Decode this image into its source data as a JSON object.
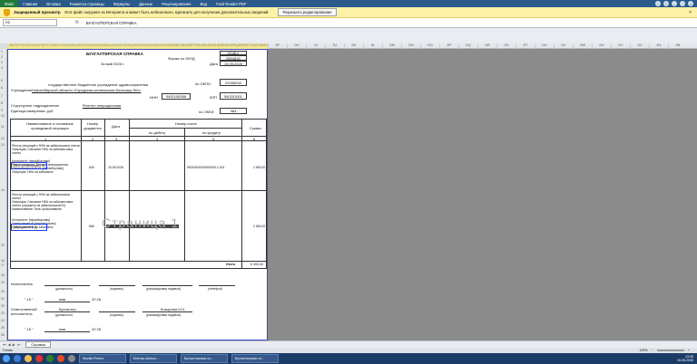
{
  "ribbon": {
    "file_tab": "Файл",
    "tabs": [
      "Главная",
      "Вставка",
      "Разметка страницы",
      "Формулы",
      "Данные",
      "Рецензирование",
      "Вид",
      "Foxit Reader PDF"
    ]
  },
  "protected_view": {
    "title": "Защищенный просмотр",
    "message": "Этот файл загружен из Интернета и может быть небезопасен. Щелкните для получения дополнительных сведений.",
    "enable_button": "Разрешить редактирование"
  },
  "formula_bar": {
    "cell": "A1",
    "fx": "fx",
    "value": "БУХГАЛТЕРСКАЯ СПРАВКА"
  },
  "column_headers": [
    "DF",
    "DH",
    "DI",
    "DJ",
    "DK",
    "DL",
    "DM",
    "DN",
    "DO",
    "DP",
    "DQ",
    "DR",
    "DS",
    "DT",
    "DU",
    "DV",
    "DW",
    "DX",
    "DY",
    "DZ",
    "EA",
    "EB"
  ],
  "row_numbers": [
    "1",
    "2",
    "3",
    "4",
    "5",
    "6",
    "7",
    "8",
    "9",
    "10",
    "11",
    "12",
    "13",
    "14",
    "15",
    "16",
    "17",
    "18",
    "19",
    "20",
    "21",
    "22",
    "23",
    "24",
    "25",
    "26"
  ],
  "document": {
    "title": "БУХГАЛТЕРСКАЯ СПРАВКА",
    "kody": "КОДЫ",
    "okud_label": "Форма по ОКУД",
    "okud": "0504833",
    "date_line": "За май 2026 г.",
    "date_label": "Дата",
    "date": "15.05.2026",
    "org1": "государственное бюджетное учреждение здравоохранения",
    "org2": "Новосибирской области «Городская клиническая больница №1»",
    "org_label": "Учреждение",
    "okpo_label": "по ОКПО",
    "okpo": "01936534",
    "inn_label": "ИНН",
    "inn": "5402108356",
    "kpp_label": "КПП",
    "kpp": "540201001",
    "dept_label": "Структурное подразделение",
    "dept": "Рентген операционная",
    "unit_label": "Единица измерения: руб.",
    "okei_label": "по ОКЕИ",
    "okei": "383",
    "col_name": "Наименование и основание проводимой операции",
    "col_num": "Номер документа",
    "col_date": "Дата",
    "col_acc": "Номер счета",
    "col_debit": "по дебету",
    "col_credit": "по кредиту",
    "col_sum": "Сумма",
    "idx": [
      "1",
      "2",
      "3",
      "4",
      "5",
      "6"
    ],
    "row1_text": [
      "Реестр операций с НФА на забалансовых счетах",
      "Операция: Списание НФА на забалансовых",
      "счетах",
      "",
      "Контрагент: [неразборчиво]",
      "Место хранения: Рентген операционная,",
      "Ответственный МОЛ: [неразборчиво]",
      "Операция: НФА на забалансе"
    ],
    "row1_tag": "[ФИО] Платонова Е.Ю.",
    "row1_num": "649",
    "row1_date": "15.05.2026",
    "row1_credit": "09010000000000000.2.021",
    "row1_sum": "2 650,00",
    "row2_text": [
      "Реестр операций с НФА на забалансовых",
      "счетах",
      "Операция: Списание НФА на забалансовых",
      "счетах (отражено на забалансовой 02)",
      "Наименование: Печь прокаливания",
      "",
      "Контрагент: [неразборчиво]",
      "Ответственный: [неразборчиво]",
      "Операция: НФА на забалансе"
    ],
    "row2_tag": "[ФИО] Шевч Б.Д.",
    "row2_num": "666",
    "row2_sum": "2 650,00",
    "total_label": "Итого",
    "total": "5 300,00",
    "exec_label": "Исполнитель",
    "sig_position": "(должность)",
    "sig_sign": "(подпись)",
    "sig_decode": "(расшифровка подписи)",
    "sig_phone": "(телефон)",
    "date_q1": "\"  15  \"",
    "date_m1": "мая",
    "date_y1": "20  26",
    "resp_label1": "Ответственный",
    "resp_label2": "исполнитель",
    "resp_position": "Бухгалтер",
    "resp_name": "Козырева Н.Н.",
    "date_q2": "\"  15  \"",
    "date_m2": "мая",
    "date_y2": "20  26",
    "watermark": "Страница 1"
  },
  "sheet_tab": "Справка",
  "status": {
    "ready": "Готово",
    "zoom": "100%"
  },
  "taskbar": {
    "tasks": [
      "Mozilla Firefox",
      "Entrezy Advisor...",
      "Бухгалтерская сп...",
      "Бухгалтерская сп..."
    ],
    "time": "13:35",
    "date": "16.05.2026"
  }
}
